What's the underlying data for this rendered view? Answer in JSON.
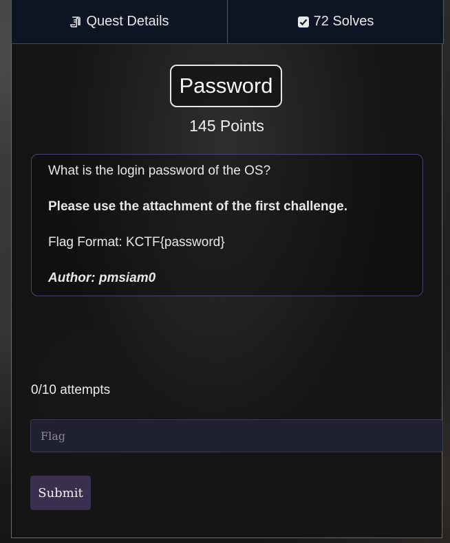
{
  "tabs": [
    {
      "label": "Quest Details",
      "icon": "scroll-icon"
    },
    {
      "label": "72 Solves",
      "icon": "checkbox-icon"
    }
  ],
  "challenge": {
    "title": "Password",
    "points": "145 Points",
    "description": {
      "question": "What is the login password of the OS?",
      "note": "Please use the attachment of the first challenge.",
      "flag_format": "Flag Format: KCTF{password}",
      "author": "Author: pmsiam0"
    }
  },
  "submission": {
    "attempts": "0/10 attempts",
    "flag_placeholder": "Flag",
    "flag_value": "",
    "submit_label": "Submit"
  },
  "colors": {
    "tab_bg": "#0d1424",
    "desc_border": "#4c4470",
    "input_bg": "#1f2030",
    "submit_bg": "#3a2f4f"
  }
}
